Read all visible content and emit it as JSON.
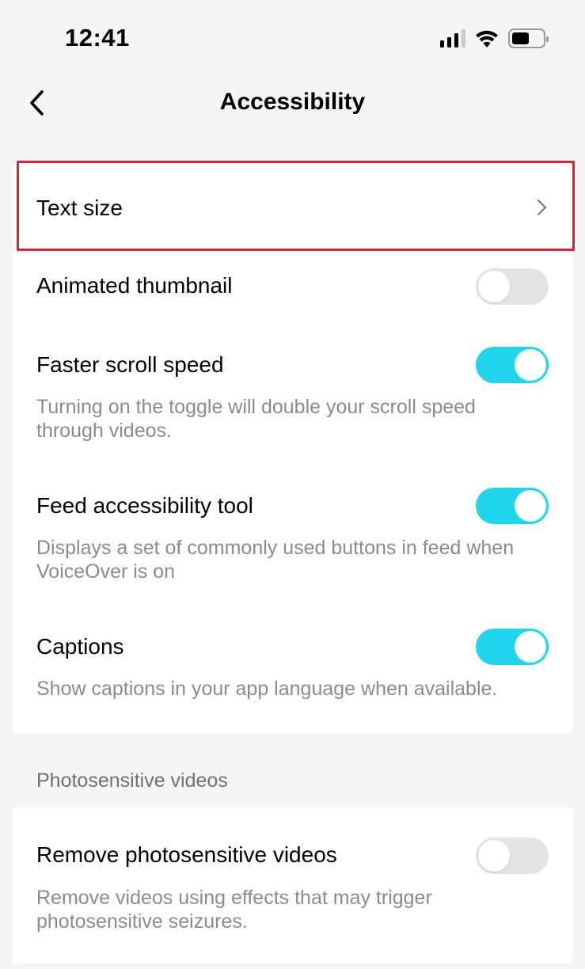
{
  "status_bar": {
    "time": "12:41",
    "icons": [
      "cellular-signal-icon",
      "wifi-icon",
      "battery-icon"
    ],
    "signal_bars_active": 3,
    "signal_bars_total": 4,
    "battery_level": 0.5
  },
  "nav": {
    "back_icon": "chevron-left-icon",
    "title": "Accessibility"
  },
  "main_settings": [
    {
      "id": "text-size",
      "title": "Text size",
      "type": "link",
      "icon": "chevron-right-icon",
      "highlighted": true
    },
    {
      "id": "animated-thumbnail",
      "title": "Animated thumbnail",
      "type": "toggle",
      "on": false
    },
    {
      "id": "faster-scroll-speed",
      "title": "Faster scroll speed",
      "type": "toggle",
      "on": true,
      "description": "Turning on the toggle will double your scroll speed through videos."
    },
    {
      "id": "feed-accessibility-tool",
      "title": "Feed accessibility tool",
      "type": "toggle",
      "on": true,
      "description": "Displays a set of commonly used buttons in feed when VoiceOver is on"
    },
    {
      "id": "captions",
      "title": "Captions",
      "type": "toggle",
      "on": true,
      "description": "Show captions in your app language when available."
    }
  ],
  "photosensitive_section": {
    "header": "Photosensitive videos",
    "items": [
      {
        "id": "remove-photosensitive-videos",
        "title": "Remove photosensitive videos",
        "type": "toggle",
        "on": false,
        "description": "Remove videos using effects that may trigger photosensitive seizures."
      }
    ]
  },
  "colors": {
    "toggle_on": "#20d5ec",
    "toggle_off": "#e3e3e4",
    "highlight": "#e3202b",
    "background": "#f5f5f5",
    "description_text": "#8a8b91"
  }
}
